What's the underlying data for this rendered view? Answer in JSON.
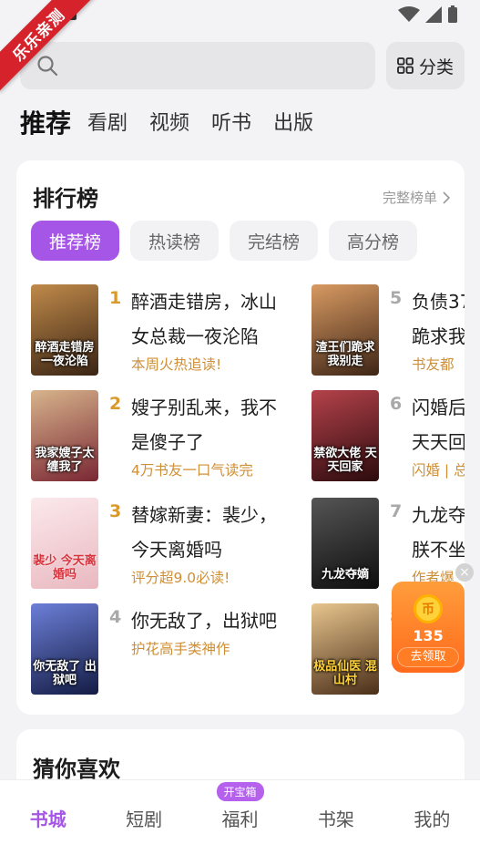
{
  "watermark": "乐乐亲测",
  "category_label": "分类",
  "top_tabs": [
    "推荐",
    "看剧",
    "视频",
    "听书",
    "出版"
  ],
  "ranking": {
    "title": "排行榜",
    "more": "完整榜单",
    "chips": [
      "推荐榜",
      "热读榜",
      "完结榜",
      "高分榜"
    ],
    "books": [
      {
        "rank": "1",
        "title": "醉酒走错房，冰山女总裁一夜沦陷",
        "tag": "本周火热追读!",
        "cover_text": "醉酒走错房 一夜沦陷",
        "cover_color": "#5a3b22"
      },
      {
        "rank": "2",
        "title": "嫂子别乱来，我不是傻子了",
        "tag": "4万书友一口气读完",
        "cover_text": "我家嫂子太缠我了",
        "cover_color": "#7a2733"
      },
      {
        "rank": "3",
        "title": "替嫁新妻：裴少，今天离婚吗",
        "tag": "评分超9.0必读!",
        "cover_text": "裴少 今天离婚吗",
        "cover_color": "#f1cfd3"
      },
      {
        "rank": "4",
        "title": "你无敌了，出狱吧",
        "tag": "护花高手类神作",
        "cover_text": "你无敌了 出狱吧",
        "cover_color": "#283a7a"
      },
      {
        "rank": "5",
        "title": "负债37",
        "tag": "书友都",
        "title2": "跪求我",
        "cover_text": "渣王们跪求我别走",
        "cover_color": "#8a4b2a"
      },
      {
        "rank": "6",
        "title": "闪婚后",
        "tag": "闪婚 | 总",
        "title2": "天天回",
        "cover_text": "禁欲大佬 天天回家",
        "cover_color": "#5c1518"
      },
      {
        "rank": "7",
        "title": "九龙夺",
        "tag": "作者爆",
        "title2": "朕不坐",
        "cover_text": "九龙夺嫡",
        "cover_color": "#2a2a2a"
      },
      {
        "rank": "8",
        "title": "",
        "tag": "",
        "title2": "",
        "cover_text": "极品仙医 混山村",
        "cover_color": "#6a4a2e"
      }
    ]
  },
  "reward": {
    "amount": "135",
    "button": "去领取",
    "coin": "币"
  },
  "guess_title": "猜你喜欢",
  "bottom_nav": [
    {
      "label": "书城",
      "active": true
    },
    {
      "label": "短剧",
      "active": false
    },
    {
      "label": "福利",
      "active": false,
      "badge": "开宝箱"
    },
    {
      "label": "书架",
      "active": false
    },
    {
      "label": "我的",
      "active": false
    }
  ]
}
